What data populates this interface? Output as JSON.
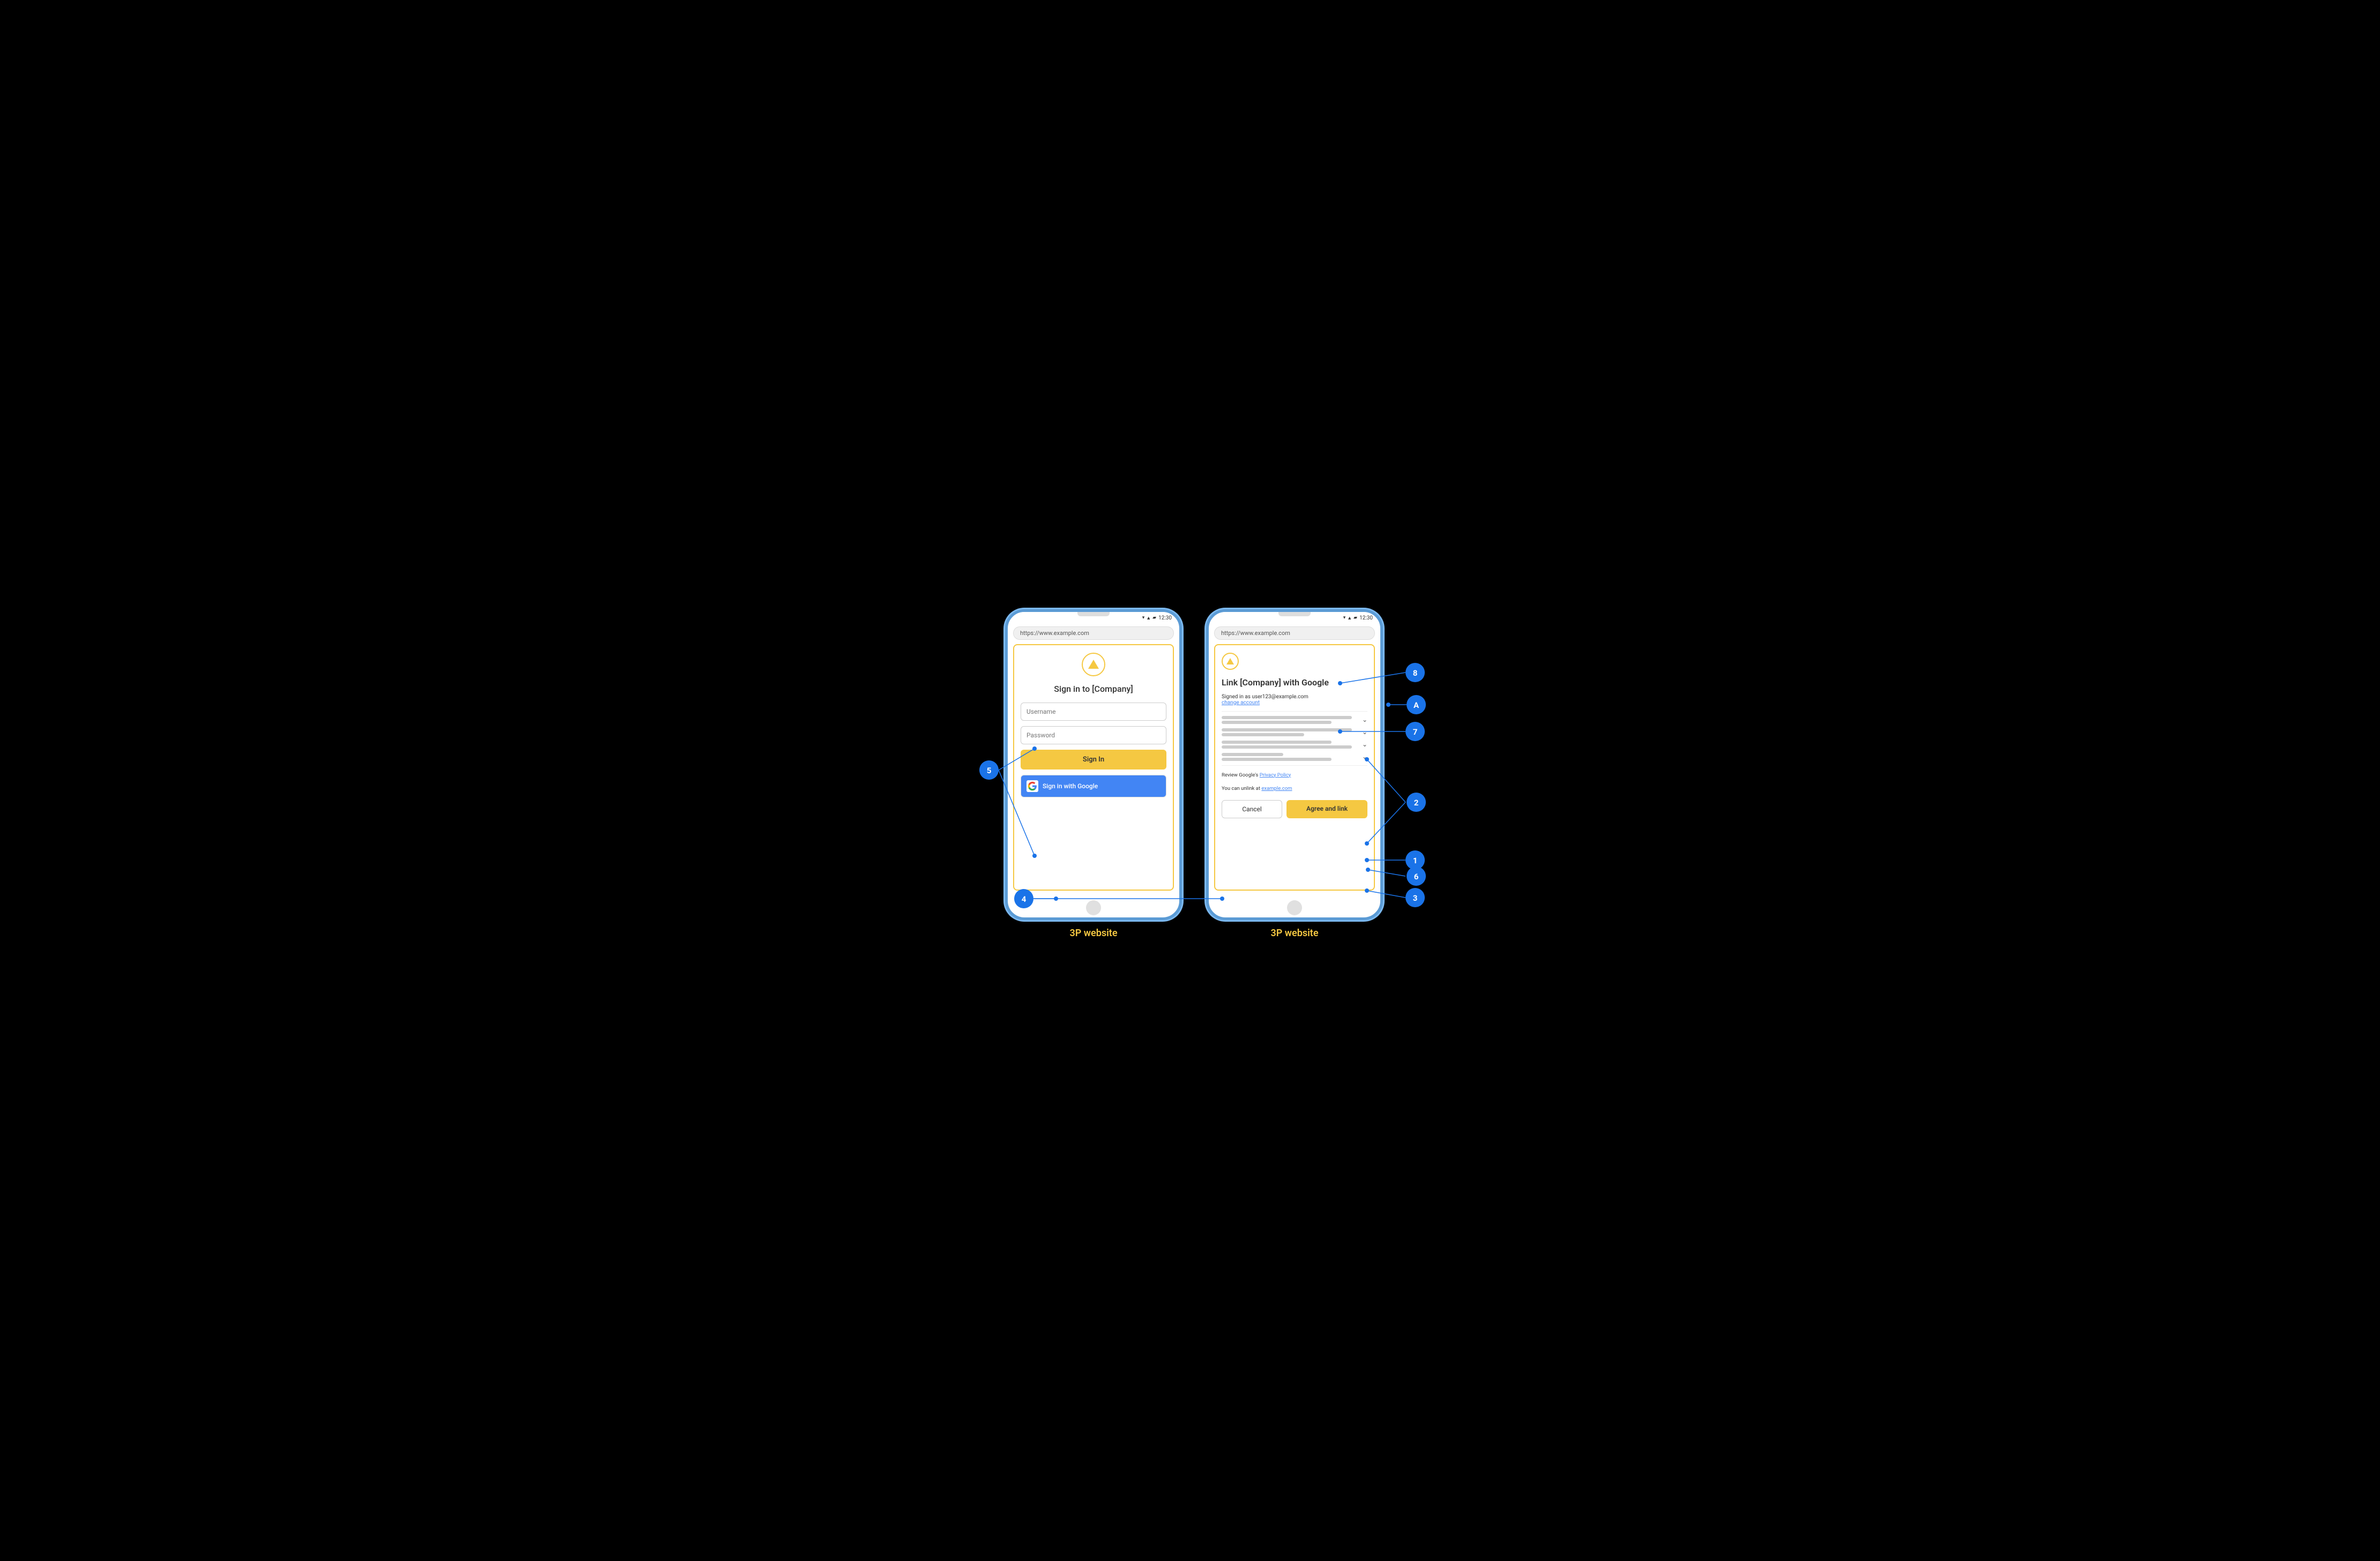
{
  "diagram": {
    "background": "#000000",
    "label_left": "3P website",
    "label_right": "3P website"
  },
  "phone_left": {
    "status_bar": {
      "time": "12:30",
      "icons": "▾▲▰"
    },
    "address_bar": "https://www.example.com",
    "sign_in_title": "Sign in to [Company]",
    "username_placeholder": "Username",
    "password_placeholder": "Password",
    "sign_in_button": "Sign In",
    "google_button": "Sign in with Google"
  },
  "phone_right": {
    "status_bar": {
      "time": "12:30"
    },
    "address_bar": "https://www.example.com",
    "link_title": "Link [Company] with Google",
    "signed_in_as": "Signed in as user123@example.com",
    "change_account": "change account",
    "policy_text1": "Review Google's ",
    "policy_link1": "Privacy Policy",
    "policy_text2": "You can unlink at ",
    "policy_link2": "example.com",
    "cancel_button": "Cancel",
    "agree_button": "Agree and link"
  },
  "annotations": {
    "bubble_5": "5",
    "bubble_4": "4",
    "bubble_8": "8",
    "bubble_A": "A",
    "bubble_7": "7",
    "bubble_2": "2",
    "bubble_1": "1",
    "bubble_6": "6",
    "bubble_3": "3"
  }
}
